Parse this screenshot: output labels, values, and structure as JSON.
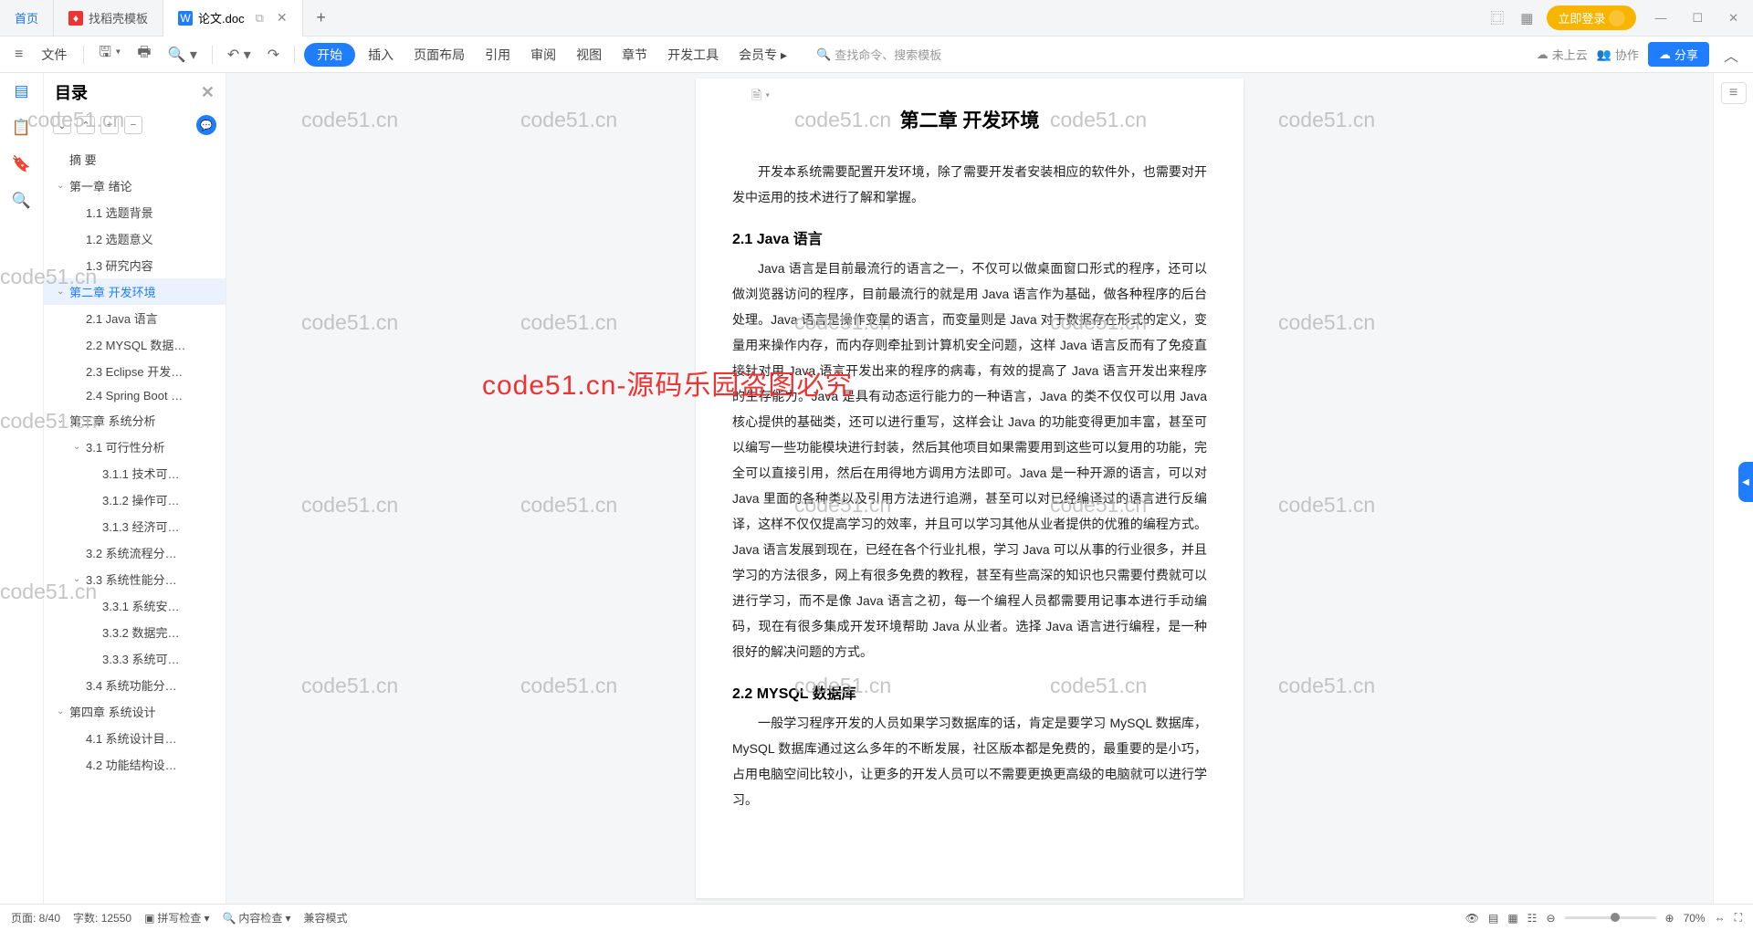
{
  "tabs": {
    "home": "首页",
    "tab1": "找稻壳模板",
    "tab2": "论文.doc"
  },
  "login": "立即登录",
  "toolbar": {
    "menu": "≡",
    "file": "文件",
    "start": "开始",
    "insert": "插入",
    "layout": "页面布局",
    "ref": "引用",
    "review": "审阅",
    "view": "视图",
    "chapter": "章节",
    "dev": "开发工具",
    "member": "会员专",
    "searchPlaceholder": "查找命令、搜索模板",
    "cloud": "未上云",
    "collab": "协作",
    "share": "分享"
  },
  "outline": {
    "title": "目录",
    "items": [
      {
        "t": "摘  要",
        "lvl": 1
      },
      {
        "t": "第一章  绪论",
        "lvl": 1,
        "caret": "v"
      },
      {
        "t": "1.1 选题背景",
        "lvl": 2
      },
      {
        "t": "1.2 选题意义",
        "lvl": 2
      },
      {
        "t": "1.3 研究内容",
        "lvl": 2
      },
      {
        "t": "第二章  开发环境",
        "lvl": 1,
        "caret": "v",
        "active": true
      },
      {
        "t": "2.1 Java 语言",
        "lvl": 2
      },
      {
        "t": "2.2 MYSQL 数据…",
        "lvl": 2
      },
      {
        "t": "2.3 Eclipse 开发…",
        "lvl": 2
      },
      {
        "t": "2.4 Spring Boot …",
        "lvl": 2
      },
      {
        "t": "第三章  系统分析",
        "lvl": 1,
        "caret": "v"
      },
      {
        "t": "3.1 可行性分析",
        "lvl": 2,
        "caret": "v"
      },
      {
        "t": "3.1.1 技术可…",
        "lvl": 3
      },
      {
        "t": "3.1.2 操作可…",
        "lvl": 3
      },
      {
        "t": "3.1.3 经济可…",
        "lvl": 3
      },
      {
        "t": "3.2 系统流程分…",
        "lvl": 2
      },
      {
        "t": "3.3 系统性能分…",
        "lvl": 2,
        "caret": "v"
      },
      {
        "t": "3.3.1 系统安…",
        "lvl": 3
      },
      {
        "t": "3.3.2 数据完…",
        "lvl": 3
      },
      {
        "t": "3.3.3 系统可…",
        "lvl": 3
      },
      {
        "t": "3.4 系统功能分…",
        "lvl": 2
      },
      {
        "t": "第四章  系统设计",
        "lvl": 1,
        "caret": "v"
      },
      {
        "t": "4.1 系统设计目…",
        "lvl": 2
      },
      {
        "t": "4.2 功能结构设…",
        "lvl": 2
      }
    ]
  },
  "doc": {
    "title": "第二章  开发环境",
    "intro": "开发本系统需要配置开发环境，除了需要开发者安装相应的软件外，也需要对开发中运用的技术进行了解和掌握。",
    "h21": "2.1 Java 语言",
    "p21": "Java 语言是目前最流行的语言之一，不仅可以做桌面窗口形式的程序，还可以做浏览器访问的程序，目前最流行的就是用 Java 语言作为基础，做各种程序的后台处理。Java 语言是操作变量的语言，而变量则是 Java 对于数据存在形式的定义，变量用来操作内存，而内存则牵扯到计算机安全问题，这样 Java 语言反而有了免疫直接针对用 Java 语言开发出来的程序的病毒，有效的提高了 Java 语言开发出来程序的生存能力。Java 是具有动态运行能力的一种语言，Java 的类不仅仅可以用 Java 核心提供的基础类，还可以进行重写，这样会让 Java 的功能变得更加丰富，甚至可以编写一些功能模块进行封装，然后其他项目如果需要用到这些可以复用的功能，完全可以直接引用，然后在用得地方调用方法即可。Java 是一种开源的语言，可以对 Java 里面的各种类以及引用方法进行追溯，甚至可以对已经编译过的语言进行反编译，这样不仅仅提高学习的效率，并且可以学习其他从业者提供的优雅的编程方式。Java 语言发展到现在，已经在各个行业扎根，学习 Java 可以从事的行业很多，并且学习的方法很多，网上有很多免费的教程，甚至有些高深的知识也只需要付费就可以进行学习，而不是像 Java 语言之初，每一个编程人员都需要用记事本进行手动编码，现在有很多集成开发环境帮助 Java 从业者。选择 Java 语言进行编程，是一种很好的解决问题的方式。",
    "h22": "2.2 MYSQL 数据库",
    "p22": "一般学习程序开发的人员如果学习数据库的话，肯定是要学习 MySQL 数据库，MySQL 数据库通过这么多年的不断发展，社区版本都是免费的，最重要的是小巧，占用电脑空间比较小，让更多的开发人员可以不需要更换更高级的电脑就可以进行学习。"
  },
  "status": {
    "page": "页面: 8/40",
    "words": "字数: 12550",
    "spell": "拼写检查",
    "content": "内容检查",
    "compat": "兼容模式",
    "zoom": "70%"
  },
  "watermark": "code51.cn",
  "watermark_red": "code51.cn-源码乐园盗图必究"
}
